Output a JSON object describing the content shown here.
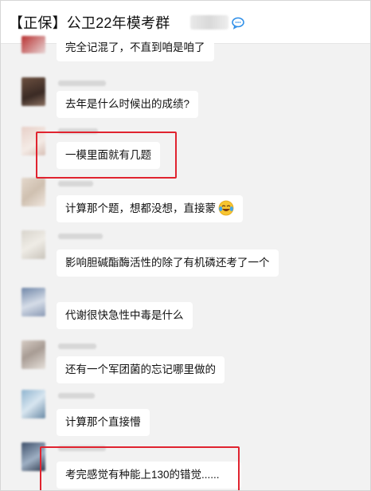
{
  "header": {
    "title": "【正保】公卫22年模考群",
    "icon": "chat-bubbles-icon"
  },
  "messages": [
    {
      "text": "完全记混了，不直到咱是咱了"
    },
    {
      "text": "去年是什么时候出的成绩?"
    },
    {
      "text": "一模里面就有几题"
    },
    {
      "text": "计算那个题，想都没想，直接蒙",
      "emoji": "laughing-crying-emoji"
    },
    {
      "text": "影响胆碱酯酶活性的除了有机磷还考了一个"
    },
    {
      "text": "代谢很快急性中毒是什么"
    },
    {
      "text": "还有一个军团菌的忘记哪里做的"
    },
    {
      "text": "计算那个直接懵"
    },
    {
      "text": "考完感觉有种能上130的错觉......"
    }
  ],
  "colors": {
    "highlight": "#e0232f",
    "chat_background": "#f2f2f2",
    "bubble": "#ffffff"
  }
}
